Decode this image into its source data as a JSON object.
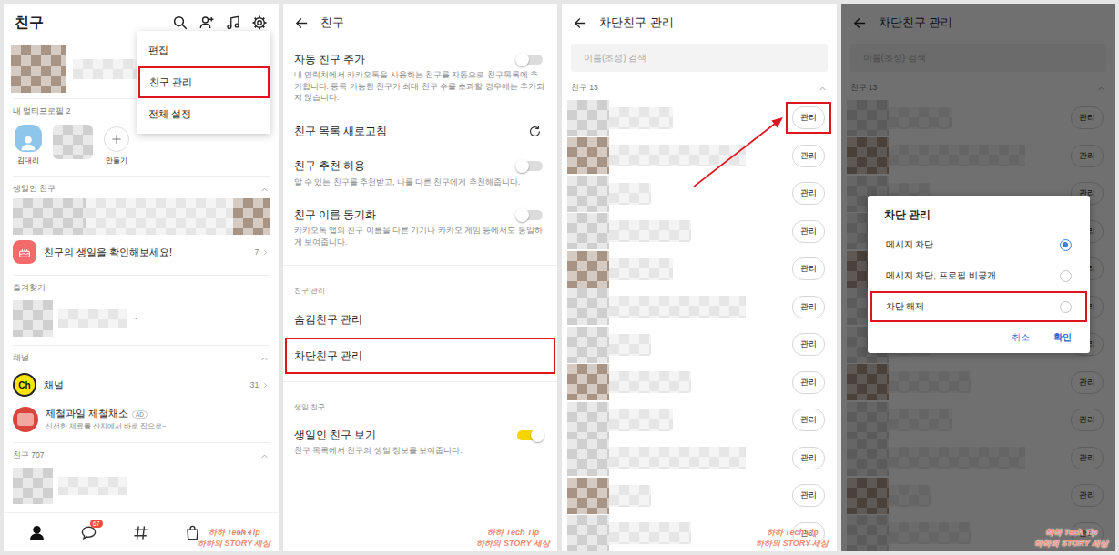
{
  "friends_screen": {
    "title": "친구",
    "menu": [
      {
        "label": "편집",
        "highlighted": false
      },
      {
        "label": "친구 관리",
        "highlighted": true
      },
      {
        "label": "전체 설정",
        "highlighted": false
      }
    ],
    "multiprofile": {
      "heading": "내 멀티프로필 2",
      "profiles": [
        {
          "kind": "avatar",
          "label": "김대리"
        },
        {
          "kind": "photo"
        },
        {
          "kind": "create",
          "label": "만들기"
        }
      ]
    },
    "birthday": {
      "heading": "생일인 친구",
      "expanded": true,
      "prompt": "친구의 생일을 확인해보세요!",
      "count": "7"
    },
    "favorites": {
      "heading": "즐겨찾기",
      "fragment": "~"
    },
    "channels": {
      "heading": "채널",
      "expanded": true,
      "items": [
        {
          "kind": "channel",
          "icon_text": "Ch",
          "name": "채널",
          "count": "31"
        },
        {
          "kind": "ad",
          "name": "제철과일 제철채소",
          "badge": "AD",
          "subtitle": "신선한 제료를 산지에서 바로 집으로~"
        }
      ]
    },
    "friends": {
      "heading": "친구 707",
      "expanded": true
    },
    "nav": [
      {
        "kind": "person",
        "selected": true
      },
      {
        "kind": "chat",
        "selected": false,
        "badge": "67"
      },
      {
        "kind": "hash",
        "selected": false
      },
      {
        "kind": "shop",
        "selected": false
      },
      {
        "kind": "more",
        "selected": false
      }
    ]
  },
  "settings_screen": {
    "title": "친구",
    "sections": [
      {
        "items": [
          {
            "kind": "toggle",
            "label": "자동 친구 추가",
            "on": false,
            "highlighted": false,
            "description": "내 연락처에서 카카오톡을 사용하는 친구를 자동으로 친구목록에 추가합니다. 등록 가능한 친구가 최대 친구 수를 초과할 경우에는 추가되지 않습니다."
          },
          {
            "kind": "action",
            "label": "친구 목록 새로고침",
            "highlighted": false
          },
          {
            "kind": "toggle",
            "label": "친구 추천 허용",
            "on": false,
            "highlighted": false,
            "description": "알 수 있는 친구를 추천받고, 나를 다른 친구에게 추천해줍니다."
          },
          {
            "kind": "toggle",
            "label": "친구 이름 동기화",
            "on": false,
            "highlighted": false,
            "description": "카카오톡 앱의 친구 이름을 다른 기기나 카카오 게임 등에서도 동일하게 보여줍니다."
          }
        ]
      },
      {
        "heading": "친구 관리",
        "items": [
          {
            "kind": "link",
            "label": "숨김친구 관리",
            "highlighted": false
          },
          {
            "kind": "link",
            "label": "차단친구 관리",
            "highlighted": true
          }
        ]
      },
      {
        "heading": "생일 친구",
        "items": [
          {
            "kind": "toggle",
            "label": "생일인 친구 보기",
            "on": true,
            "highlighted": false,
            "description": "친구 목록에서 친구의 생일 정보를 보여줍니다."
          }
        ]
      }
    ]
  },
  "blocked_screen": {
    "title": "차단친구 관리",
    "search_placeholder": "이름(초성) 검색",
    "group": {
      "heading": "친구 13",
      "expanded": true
    },
    "rows": [
      {
        "button": "관리",
        "highlighted": true
      },
      {
        "button": "관리",
        "highlighted": false
      },
      {
        "button": "관리",
        "highlighted": false
      },
      {
        "button": "관리",
        "highlighted": false
      },
      {
        "button": "관리",
        "highlighted": false
      },
      {
        "button": "관리",
        "highlighted": false
      },
      {
        "button": "관리",
        "highlighted": false
      },
      {
        "button": "관리",
        "highlighted": false
      },
      {
        "button": "관리",
        "highlighted": false
      },
      {
        "button": "관리",
        "highlighted": false
      },
      {
        "button": "관리",
        "highlighted": false
      },
      {
        "button": "관리",
        "highlighted": false
      }
    ]
  },
  "dialog_screen": {
    "title": "차단친구 관리",
    "search_placeholder": "이름(초성) 검색",
    "group": {
      "heading": "친구 13",
      "expanded": true
    },
    "rows": [
      {
        "button": "관리",
        "highlighted": false
      },
      {
        "button": "관리",
        "highlighted": false
      },
      {
        "button": "관리",
        "highlighted": false
      },
      {
        "button": "관리",
        "highlighted": false
      },
      {
        "button": "관리",
        "highlighted": false
      },
      {
        "button": "관리",
        "highlighted": false
      },
      {
        "button": "관리",
        "highlighted": false
      },
      {
        "button": "관리",
        "highlighted": false
      },
      {
        "button": "관리",
        "highlighted": false
      },
      {
        "button": "관리",
        "highlighted": false
      },
      {
        "button": "관리",
        "highlighted": false
      },
      {
        "button": "관리",
        "highlighted": false
      }
    ],
    "dialog": {
      "title": "차단 관리",
      "options": [
        {
          "label": "메시지 차단",
          "selected": true,
          "highlighted": false
        },
        {
          "label": "메시지 차단, 프로필 비공개",
          "selected": false,
          "highlighted": false
        },
        {
          "label": "차단 해제",
          "selected": false,
          "highlighted": true
        }
      ],
      "buttons": [
        {
          "label": "취소",
          "primary": false
        },
        {
          "label": "확인",
          "primary": true
        }
      ]
    }
  },
  "watermark": {
    "lines": [
      "하하 Tech Tip",
      "하하의 STORY 세상"
    ]
  }
}
